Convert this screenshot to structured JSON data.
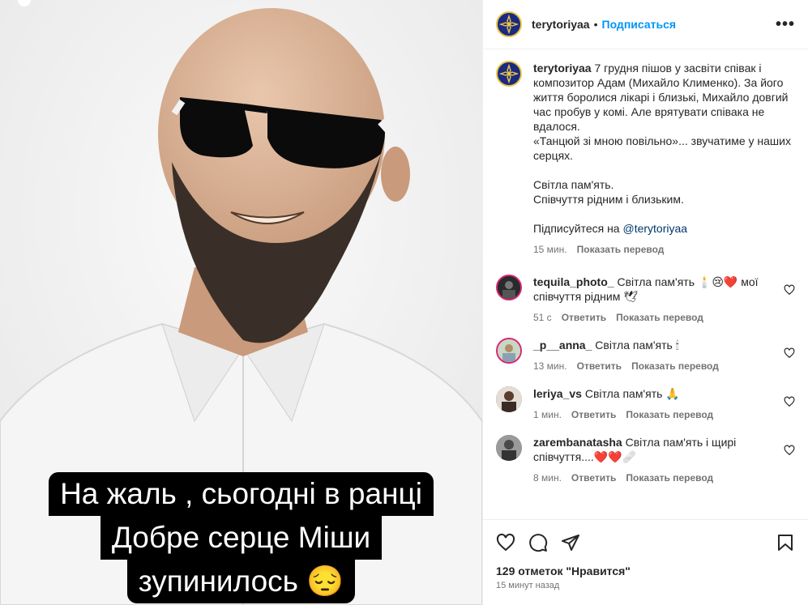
{
  "post": {
    "author": "terytoriyaa",
    "separator": "•",
    "follow_label": "Подписаться",
    "more_label": "•••",
    "image_caption_lines": [
      "На жаль , сьогодні в ранці",
      "Добре серце Міши",
      "зупинилось 😔"
    ]
  },
  "caption": {
    "username": "terytoriyaa",
    "text1": "7 грудня пішов у засвіти співак і композитор Адам (Михайло Клименко). За його життя боролися лікарі і близькі, Михайло довгий час пробув у комі. Але врятувати співака не вдалося.",
    "text2": "«Танцюй зі мною повільно»... звучатиме у наших серцях.",
    "text3": "Світла пам'ять.",
    "text4": "Співчуття рідним і близьким.",
    "text5_prefix": "Підписуйтеся на ",
    "text5_link": "@terytoriyaa",
    "time": "15 мин.",
    "translate": "Показать перевод"
  },
  "comments": [
    {
      "username": "tequila_photo_",
      "text": "Світла пам'ять 🕯️😢❤️ мої співчуття рідним 🕊",
      "time": "51 с",
      "reply": "Ответить",
      "translate": "Показать перевод"
    },
    {
      "username": "_p__anna_",
      "text": "Світла пам'ять 🕯",
      "time": "13 мин.",
      "reply": "Ответить",
      "translate": "Показать перевод"
    },
    {
      "username": "leriya_vs",
      "text": "Світла пам'ять 🙏",
      "time": "1 мин.",
      "reply": "Ответить",
      "translate": "Показать перевод"
    },
    {
      "username": "zarembanatasha",
      "text": "Світла пам'ять і щирі співчуття....❤️❤️🩹",
      "time": "8 мин.",
      "reply": "Ответить",
      "translate": "Показать перевод"
    }
  ],
  "footer": {
    "likes": "129 отметок \"Нравится\"",
    "posted": "15 минут назад"
  },
  "colors": {
    "accent": "#0095f6",
    "link": "#00376b",
    "muted": "#737373"
  }
}
